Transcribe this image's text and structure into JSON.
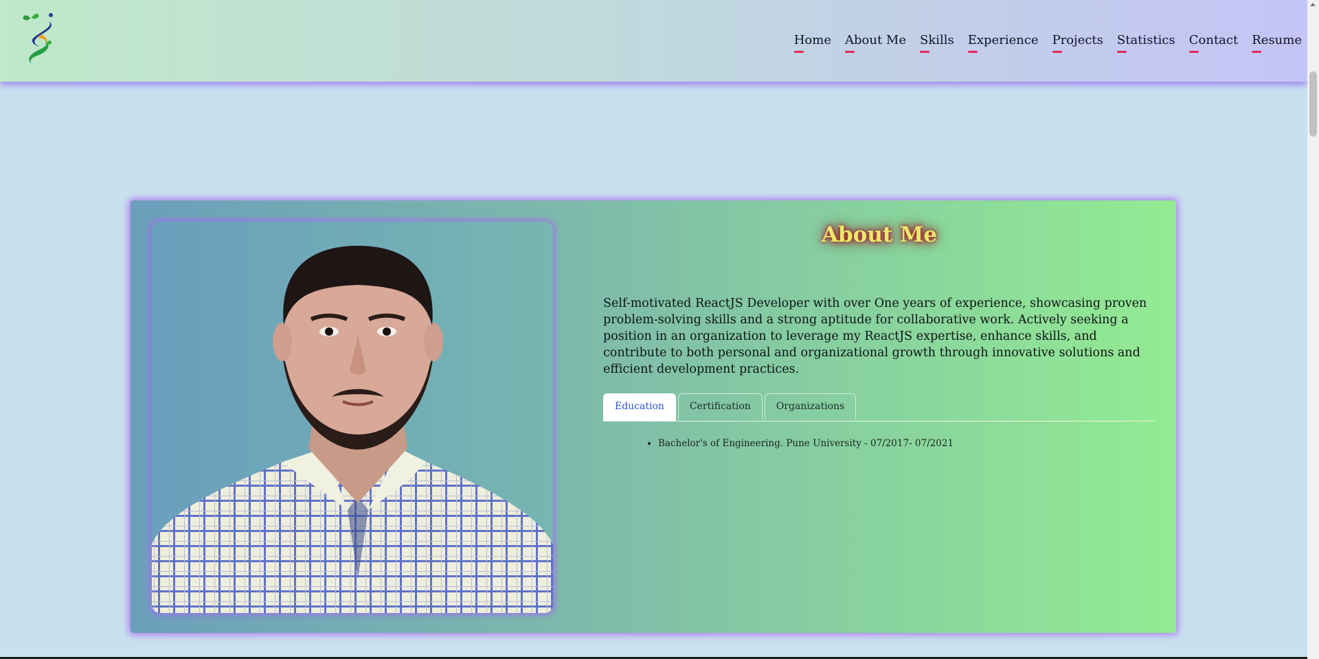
{
  "header": {
    "logo_name": "leaf-helix-logo",
    "nav": [
      {
        "label": "Home"
      },
      {
        "label": "About Me"
      },
      {
        "label": "Skills"
      },
      {
        "label": "Experience"
      },
      {
        "label": "Projects"
      },
      {
        "label": "Statistics"
      },
      {
        "label": "Contact"
      },
      {
        "label": "Resume"
      }
    ],
    "underline_color": "#e8245a"
  },
  "about": {
    "title": "About Me",
    "description": "Self-motivated ReactJS Developer with over One years of experience, showcasing proven problem-solving skills and a strong aptitude for collaborative work. Actively seeking a position in an organization to leverage my ReactJS expertise, enhance skills, and contribute to both personal and organizational growth through innovative solutions and efficient development practices.",
    "tabs": [
      {
        "label": "Education",
        "active": true
      },
      {
        "label": "Certification",
        "active": false
      },
      {
        "label": "Organizations",
        "active": false
      }
    ],
    "active_tab_items": [
      "Bachelor's of Engineering. Pune University - 07/2017- 07/2021"
    ]
  },
  "colors": {
    "title_text": "#e8ea6a",
    "title_glow": "#b0001a",
    "active_tab_text": "#2a52c7"
  }
}
